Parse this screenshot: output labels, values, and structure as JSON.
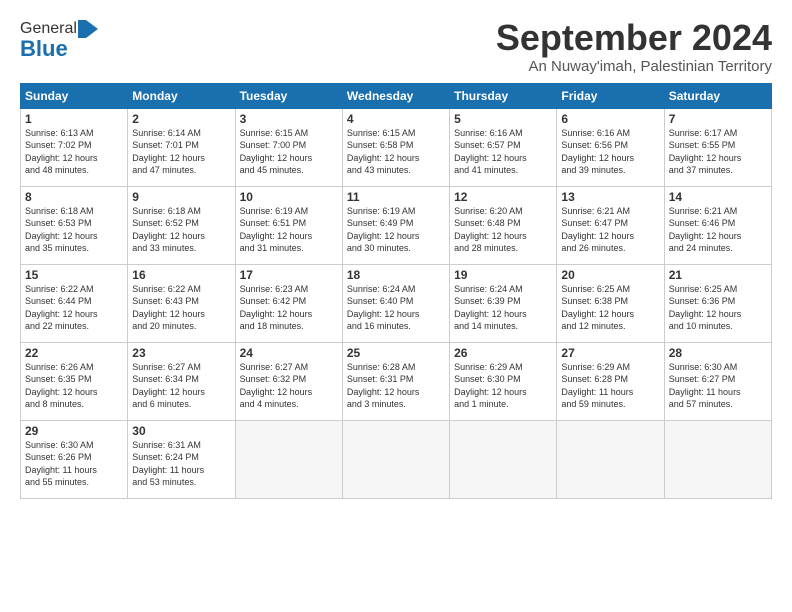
{
  "header": {
    "logo_general": "General",
    "logo_blue": "Blue",
    "month_title": "September 2024",
    "subtitle": "An Nuway'imah, Palestinian Territory"
  },
  "days_of_week": [
    "Sunday",
    "Monday",
    "Tuesday",
    "Wednesday",
    "Thursday",
    "Friday",
    "Saturday"
  ],
  "weeks": [
    [
      {
        "day": "1",
        "info": "Sunrise: 6:13 AM\nSunset: 7:02 PM\nDaylight: 12 hours\nand 48 minutes."
      },
      {
        "day": "2",
        "info": "Sunrise: 6:14 AM\nSunset: 7:01 PM\nDaylight: 12 hours\nand 47 minutes."
      },
      {
        "day": "3",
        "info": "Sunrise: 6:15 AM\nSunset: 7:00 PM\nDaylight: 12 hours\nand 45 minutes."
      },
      {
        "day": "4",
        "info": "Sunrise: 6:15 AM\nSunset: 6:58 PM\nDaylight: 12 hours\nand 43 minutes."
      },
      {
        "day": "5",
        "info": "Sunrise: 6:16 AM\nSunset: 6:57 PM\nDaylight: 12 hours\nand 41 minutes."
      },
      {
        "day": "6",
        "info": "Sunrise: 6:16 AM\nSunset: 6:56 PM\nDaylight: 12 hours\nand 39 minutes."
      },
      {
        "day": "7",
        "info": "Sunrise: 6:17 AM\nSunset: 6:55 PM\nDaylight: 12 hours\nand 37 minutes."
      }
    ],
    [
      {
        "day": "8",
        "info": "Sunrise: 6:18 AM\nSunset: 6:53 PM\nDaylight: 12 hours\nand 35 minutes."
      },
      {
        "day": "9",
        "info": "Sunrise: 6:18 AM\nSunset: 6:52 PM\nDaylight: 12 hours\nand 33 minutes."
      },
      {
        "day": "10",
        "info": "Sunrise: 6:19 AM\nSunset: 6:51 PM\nDaylight: 12 hours\nand 31 minutes."
      },
      {
        "day": "11",
        "info": "Sunrise: 6:19 AM\nSunset: 6:49 PM\nDaylight: 12 hours\nand 30 minutes."
      },
      {
        "day": "12",
        "info": "Sunrise: 6:20 AM\nSunset: 6:48 PM\nDaylight: 12 hours\nand 28 minutes."
      },
      {
        "day": "13",
        "info": "Sunrise: 6:21 AM\nSunset: 6:47 PM\nDaylight: 12 hours\nand 26 minutes."
      },
      {
        "day": "14",
        "info": "Sunrise: 6:21 AM\nSunset: 6:46 PM\nDaylight: 12 hours\nand 24 minutes."
      }
    ],
    [
      {
        "day": "15",
        "info": "Sunrise: 6:22 AM\nSunset: 6:44 PM\nDaylight: 12 hours\nand 22 minutes."
      },
      {
        "day": "16",
        "info": "Sunrise: 6:22 AM\nSunset: 6:43 PM\nDaylight: 12 hours\nand 20 minutes."
      },
      {
        "day": "17",
        "info": "Sunrise: 6:23 AM\nSunset: 6:42 PM\nDaylight: 12 hours\nand 18 minutes."
      },
      {
        "day": "18",
        "info": "Sunrise: 6:24 AM\nSunset: 6:40 PM\nDaylight: 12 hours\nand 16 minutes."
      },
      {
        "day": "19",
        "info": "Sunrise: 6:24 AM\nSunset: 6:39 PM\nDaylight: 12 hours\nand 14 minutes."
      },
      {
        "day": "20",
        "info": "Sunrise: 6:25 AM\nSunset: 6:38 PM\nDaylight: 12 hours\nand 12 minutes."
      },
      {
        "day": "21",
        "info": "Sunrise: 6:25 AM\nSunset: 6:36 PM\nDaylight: 12 hours\nand 10 minutes."
      }
    ],
    [
      {
        "day": "22",
        "info": "Sunrise: 6:26 AM\nSunset: 6:35 PM\nDaylight: 12 hours\nand 8 minutes."
      },
      {
        "day": "23",
        "info": "Sunrise: 6:27 AM\nSunset: 6:34 PM\nDaylight: 12 hours\nand 6 minutes."
      },
      {
        "day": "24",
        "info": "Sunrise: 6:27 AM\nSunset: 6:32 PM\nDaylight: 12 hours\nand 4 minutes."
      },
      {
        "day": "25",
        "info": "Sunrise: 6:28 AM\nSunset: 6:31 PM\nDaylight: 12 hours\nand 3 minutes."
      },
      {
        "day": "26",
        "info": "Sunrise: 6:29 AM\nSunset: 6:30 PM\nDaylight: 12 hours\nand 1 minute."
      },
      {
        "day": "27",
        "info": "Sunrise: 6:29 AM\nSunset: 6:28 PM\nDaylight: 11 hours\nand 59 minutes."
      },
      {
        "day": "28",
        "info": "Sunrise: 6:30 AM\nSunset: 6:27 PM\nDaylight: 11 hours\nand 57 minutes."
      }
    ],
    [
      {
        "day": "29",
        "info": "Sunrise: 6:30 AM\nSunset: 6:26 PM\nDaylight: 11 hours\nand 55 minutes."
      },
      {
        "day": "30",
        "info": "Sunrise: 6:31 AM\nSunset: 6:24 PM\nDaylight: 11 hours\nand 53 minutes."
      },
      {
        "day": "",
        "info": ""
      },
      {
        "day": "",
        "info": ""
      },
      {
        "day": "",
        "info": ""
      },
      {
        "day": "",
        "info": ""
      },
      {
        "day": "",
        "info": ""
      }
    ]
  ]
}
